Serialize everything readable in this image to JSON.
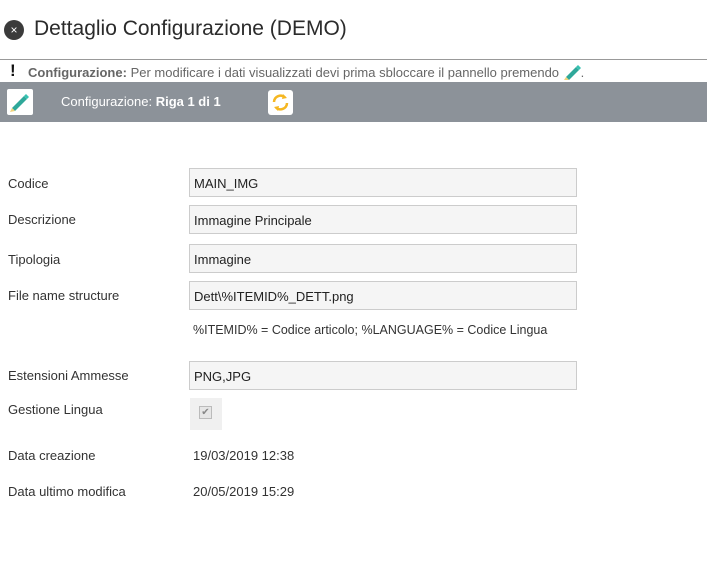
{
  "window": {
    "title": "Dettaglio Configurazione (DEMO)",
    "close_icon": "×"
  },
  "notice": {
    "icon": "!",
    "label": "Configurazione:",
    "text": "Per modificare i dati visualizzati devi prima sbloccare il pannello premendo",
    "suffix": "."
  },
  "toolbar": {
    "prefix": "Configurazione:",
    "record": "Riga 1 di 1"
  },
  "form": {
    "codice": {
      "label": "Codice",
      "value": "MAIN_IMG"
    },
    "descrizione": {
      "label": "Descrizione",
      "value": "Immagine Principale"
    },
    "tipologia": {
      "label": "Tipologia",
      "value": "Immagine"
    },
    "file_name": {
      "label": "File name structure",
      "value": "Dett\\%ITEMID%_DETT.png",
      "hint": "%ITEMID% = Codice articolo; %LANGUAGE% = Codice Lingua"
    },
    "estensioni": {
      "label": "Estensioni Ammesse",
      "value": "PNG,JPG"
    },
    "gestione_lingua": {
      "label": "Gestione Lingua",
      "checked": true,
      "check_glyph": "✔"
    },
    "data_creazione": {
      "label": "Data creazione",
      "value": "19/03/2019 12:38"
    },
    "data_modifica": {
      "label": "Data ultimo modifica",
      "value": "20/05/2019 15:29"
    }
  },
  "colors": {
    "toolbar_bg": "#8c9299",
    "pencil": "#2fa89a",
    "refresh": "#f5b722"
  }
}
